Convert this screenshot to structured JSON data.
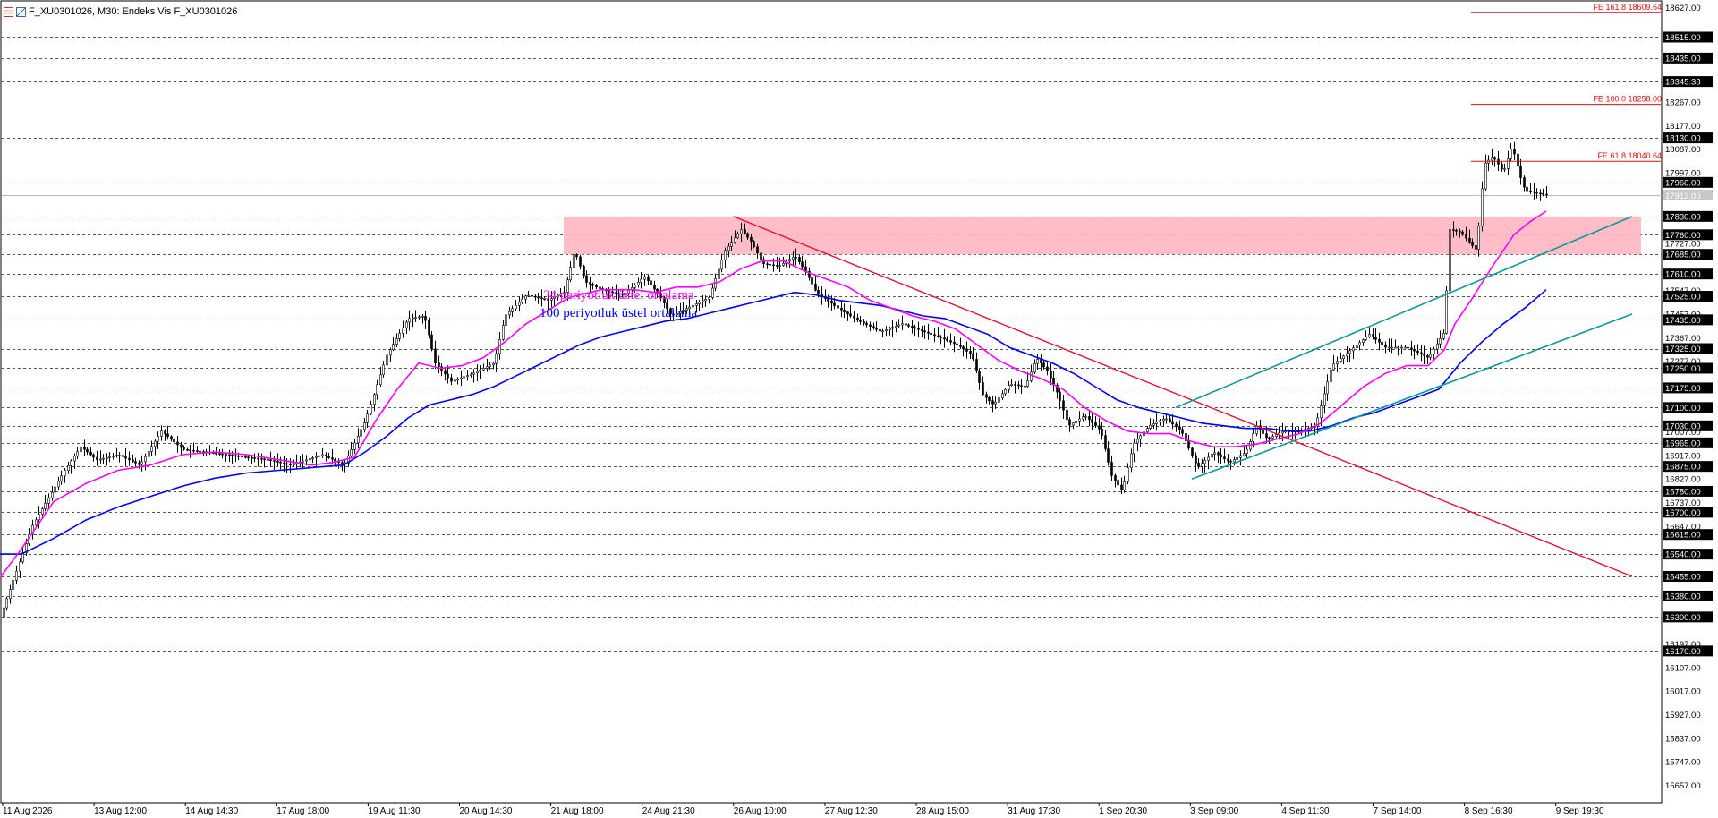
{
  "window": {
    "title": "F_XU0301026, M30:  Endeks Vis F_XU0301026",
    "icons": [
      "chart-table-icon",
      "chart-type-icon"
    ]
  },
  "annotations": {
    "ema34": "34 periyotluk üstel ortalama",
    "ema100": "100 periyotluk üstel ortalama"
  },
  "colors": {
    "ema34": "#ff00ff",
    "ema100": "#0000ff",
    "zone": "#ffb6c1",
    "downtrend": "#e8102a",
    "channel": "#0a9a9a",
    "fib": "#e01010"
  },
  "chart_data": {
    "type": "candlestick",
    "symbol": "F_XU0301026",
    "timeframe": "M30",
    "y_range": [
      15590,
      18650
    ],
    "y_ticks": [
      "18627.00",
      "18515.00",
      "18435.00",
      "18345.38",
      "18267.00",
      "18177.00",
      "18130.00",
      "18087.00",
      "17997.00",
      "17960.00",
      "17913.00",
      "17830.00",
      "17760.00",
      "17727.00",
      "17685.00",
      "17610.00",
      "17547.00",
      "17525.00",
      "17457.00",
      "17435.00",
      "17367.00",
      "17325.00",
      "17277.00",
      "17250.00",
      "17175.00",
      "17100.00",
      "17030.00",
      "17007.00",
      "16965.00",
      "16917.00",
      "16875.00",
      "16827.00",
      "16780.00",
      "16737.00",
      "16700.00",
      "16647.00",
      "16615.00",
      "16540.00",
      "16455.00",
      "16380.00",
      "16300.00",
      "16197.00",
      "16170.00",
      "16107.00",
      "16017.00",
      "15927.00",
      "15837.00",
      "15747.00",
      "15657.00"
    ],
    "highlighted_levels": [
      "18515.00",
      "18435.00",
      "18345.38",
      "18130.00",
      "17960.00",
      "17830.00",
      "17760.00",
      "17685.00",
      "17610.00",
      "17525.00",
      "17435.00",
      "17325.00",
      "17250.00",
      "17175.00",
      "17100.00",
      "17030.00",
      "16965.00",
      "16875.00",
      "16780.00",
      "16700.00",
      "16615.00",
      "16540.00",
      "16455.00",
      "16380.00",
      "16300.00",
      "16170.00"
    ],
    "current_price": "17913.00",
    "x_labels": [
      "11 Aug 2026",
      "13 Aug 12:00",
      "14 Aug 14:30",
      "17 Aug 18:00",
      "19 Aug 11:30",
      "20 Aug 14:30",
      "21 Aug 18:00",
      "24 Aug 21:30",
      "26 Aug 10:00",
      "27 Aug 12:30",
      "28 Aug 15:00",
      "31 Aug 17:30",
      "1 Sep 20:30",
      "3 Sep 09:00",
      "4 Sep 11:30",
      "7 Sep 14:00",
      "8 Sep 16:30",
      "9 Sep 19:30"
    ],
    "price_path_approx": [
      [
        0,
        16300
      ],
      [
        30,
        16650
      ],
      [
        60,
        16860
      ],
      [
        75,
        16950
      ],
      [
        90,
        16900
      ],
      [
        110,
        16920
      ],
      [
        130,
        16880
      ],
      [
        150,
        17010
      ],
      [
        170,
        16940
      ],
      [
        190,
        16930
      ],
      [
        210,
        16920
      ],
      [
        230,
        16910
      ],
      [
        250,
        16900
      ],
      [
        270,
        16880
      ],
      [
        300,
        16920
      ],
      [
        320,
        16880
      ],
      [
        340,
        17050
      ],
      [
        360,
        17300
      ],
      [
        380,
        17440
      ],
      [
        395,
        17450
      ],
      [
        405,
        17270
      ],
      [
        420,
        17200
      ],
      [
        440,
        17230
      ],
      [
        460,
        17270
      ],
      [
        470,
        17450
      ],
      [
        490,
        17530
      ],
      [
        510,
        17510
      ],
      [
        525,
        17540
      ],
      [
        535,
        17700
      ],
      [
        545,
        17580
      ],
      [
        560,
        17550
      ],
      [
        580,
        17530
      ],
      [
        600,
        17600
      ],
      [
        615,
        17520
      ],
      [
        625,
        17450
      ],
      [
        640,
        17480
      ],
      [
        660,
        17520
      ],
      [
        675,
        17700
      ],
      [
        690,
        17780
      ],
      [
        700,
        17730
      ],
      [
        710,
        17650
      ],
      [
        725,
        17640
      ],
      [
        740,
        17680
      ],
      [
        750,
        17620
      ],
      [
        760,
        17540
      ],
      [
        780,
        17480
      ],
      [
        800,
        17430
      ],
      [
        820,
        17390
      ],
      [
        840,
        17420
      ],
      [
        860,
        17390
      ],
      [
        880,
        17360
      ],
      [
        895,
        17330
      ],
      [
        905,
        17300
      ],
      [
        915,
        17150
      ],
      [
        925,
        17110
      ],
      [
        940,
        17190
      ],
      [
        955,
        17180
      ],
      [
        965,
        17290
      ],
      [
        975,
        17240
      ],
      [
        985,
        17150
      ],
      [
        995,
        17030
      ],
      [
        1010,
        17070
      ],
      [
        1025,
        17010
      ],
      [
        1035,
        16840
      ],
      [
        1045,
        16780
      ],
      [
        1055,
        16960
      ],
      [
        1070,
        17030
      ],
      [
        1085,
        17060
      ],
      [
        1100,
        17010
      ],
      [
        1115,
        16870
      ],
      [
        1130,
        16930
      ],
      [
        1145,
        16890
      ],
      [
        1160,
        16930
      ],
      [
        1170,
        17030
      ],
      [
        1180,
        16980
      ],
      [
        1195,
        17010
      ],
      [
        1210,
        17010
      ],
      [
        1225,
        17030
      ],
      [
        1240,
        17260
      ],
      [
        1255,
        17310
      ],
      [
        1275,
        17380
      ],
      [
        1290,
        17330
      ],
      [
        1310,
        17330
      ],
      [
        1330,
        17290
      ],
      [
        1345,
        17390
      ],
      [
        1350,
        17780
      ],
      [
        1360,
        17770
      ],
      [
        1375,
        17700
      ],
      [
        1382,
        18030
      ],
      [
        1390,
        18060
      ],
      [
        1400,
        18000
      ],
      [
        1408,
        18100
      ],
      [
        1415,
        17990
      ],
      [
        1420,
        17930
      ],
      [
        1430,
        17920
      ],
      [
        1440,
        17913
      ]
    ],
    "ema34_path_approx": [
      [
        0,
        16450
      ],
      [
        20,
        16560
      ],
      [
        50,
        16740
      ],
      [
        80,
        16810
      ],
      [
        110,
        16860
      ],
      [
        140,
        16880
      ],
      [
        170,
        16920
      ],
      [
        200,
        16930
      ],
      [
        230,
        16920
      ],
      [
        260,
        16900
      ],
      [
        290,
        16880
      ],
      [
        310,
        16890
      ],
      [
        330,
        16910
      ],
      [
        350,
        17050
      ],
      [
        370,
        17170
      ],
      [
        390,
        17270
      ],
      [
        410,
        17250
      ],
      [
        430,
        17260
      ],
      [
        450,
        17290
      ],
      [
        470,
        17350
      ],
      [
        490,
        17420
      ],
      [
        510,
        17470
      ],
      [
        530,
        17520
      ],
      [
        560,
        17550
      ],
      [
        590,
        17550
      ],
      [
        610,
        17540
      ],
      [
        630,
        17560
      ],
      [
        650,
        17560
      ],
      [
        670,
        17580
      ],
      [
        690,
        17630
      ],
      [
        710,
        17660
      ],
      [
        730,
        17660
      ],
      [
        750,
        17620
      ],
      [
        770,
        17590
      ],
      [
        790,
        17560
      ],
      [
        810,
        17510
      ],
      [
        830,
        17480
      ],
      [
        850,
        17450
      ],
      [
        870,
        17430
      ],
      [
        890,
        17400
      ],
      [
        910,
        17340
      ],
      [
        930,
        17280
      ],
      [
        950,
        17240
      ],
      [
        970,
        17210
      ],
      [
        990,
        17170
      ],
      [
        1010,
        17100
      ],
      [
        1030,
        17050
      ],
      [
        1050,
        17010
      ],
      [
        1070,
        17000
      ],
      [
        1090,
        17000
      ],
      [
        1110,
        16970
      ],
      [
        1130,
        16950
      ],
      [
        1150,
        16950
      ],
      [
        1170,
        16960
      ],
      [
        1190,
        16980
      ],
      [
        1210,
        17000
      ],
      [
        1230,
        17040
      ],
      [
        1250,
        17110
      ],
      [
        1270,
        17180
      ],
      [
        1290,
        17230
      ],
      [
        1310,
        17260
      ],
      [
        1330,
        17260
      ],
      [
        1345,
        17320
      ],
      [
        1355,
        17420
      ],
      [
        1370,
        17510
      ],
      [
        1390,
        17640
      ],
      [
        1410,
        17760
      ],
      [
        1425,
        17810
      ],
      [
        1440,
        17850
      ]
    ],
    "ema100_path_approx": [
      [
        0,
        16540
      ],
      [
        20,
        16540
      ],
      [
        50,
        16600
      ],
      [
        80,
        16670
      ],
      [
        110,
        16720
      ],
      [
        140,
        16760
      ],
      [
        170,
        16800
      ],
      [
        200,
        16830
      ],
      [
        230,
        16850
      ],
      [
        260,
        16860
      ],
      [
        290,
        16870
      ],
      [
        320,
        16880
      ],
      [
        340,
        16930
      ],
      [
        360,
        16990
      ],
      [
        380,
        17060
      ],
      [
        400,
        17110
      ],
      [
        420,
        17130
      ],
      [
        440,
        17150
      ],
      [
        460,
        17180
      ],
      [
        480,
        17220
      ],
      [
        500,
        17260
      ],
      [
        520,
        17300
      ],
      [
        540,
        17340
      ],
      [
        560,
        17370
      ],
      [
        580,
        17390
      ],
      [
        600,
        17410
      ],
      [
        620,
        17430
      ],
      [
        640,
        17440
      ],
      [
        660,
        17460
      ],
      [
        680,
        17480
      ],
      [
        700,
        17500
      ],
      [
        720,
        17520
      ],
      [
        740,
        17540
      ],
      [
        760,
        17530
      ],
      [
        780,
        17510
      ],
      [
        800,
        17500
      ],
      [
        820,
        17490
      ],
      [
        840,
        17470
      ],
      [
        860,
        17450
      ],
      [
        880,
        17440
      ],
      [
        900,
        17410
      ],
      [
        920,
        17380
      ],
      [
        940,
        17330
      ],
      [
        960,
        17300
      ],
      [
        980,
        17270
      ],
      [
        1000,
        17230
      ],
      [
        1020,
        17180
      ],
      [
        1040,
        17130
      ],
      [
        1060,
        17100
      ],
      [
        1080,
        17080
      ],
      [
        1100,
        17060
      ],
      [
        1120,
        17040
      ],
      [
        1140,
        17030
      ],
      [
        1160,
        17020
      ],
      [
        1180,
        17020
      ],
      [
        1200,
        17010
      ],
      [
        1220,
        17010
      ],
      [
        1240,
        17030
      ],
      [
        1260,
        17060
      ],
      [
        1280,
        17080
      ],
      [
        1300,
        17110
      ],
      [
        1320,
        17140
      ],
      [
        1340,
        17170
      ],
      [
        1360,
        17270
      ],
      [
        1380,
        17350
      ],
      [
        1400,
        17420
      ],
      [
        1420,
        17480
      ],
      [
        1440,
        17550
      ]
    ]
  },
  "fibonacci": [
    {
      "label": "FE 161.8 18609.64",
      "value": 18609.64
    },
    {
      "label": "FE 100.0 18258.00",
      "value": 18258.0
    },
    {
      "label": "FE 61.8 18040.64",
      "value": 18040.64
    }
  ],
  "resistance_zone": [
    17685,
    17830
  ],
  "downtrend_line": [
    [
      683,
      17830
    ],
    [
      1520,
      16455
    ]
  ],
  "channel_lines": [
    [
      [
        1095,
        17100
      ],
      [
        1520,
        17830
      ]
    ],
    [
      [
        1110,
        16827
      ],
      [
        1520,
        17457
      ]
    ]
  ]
}
